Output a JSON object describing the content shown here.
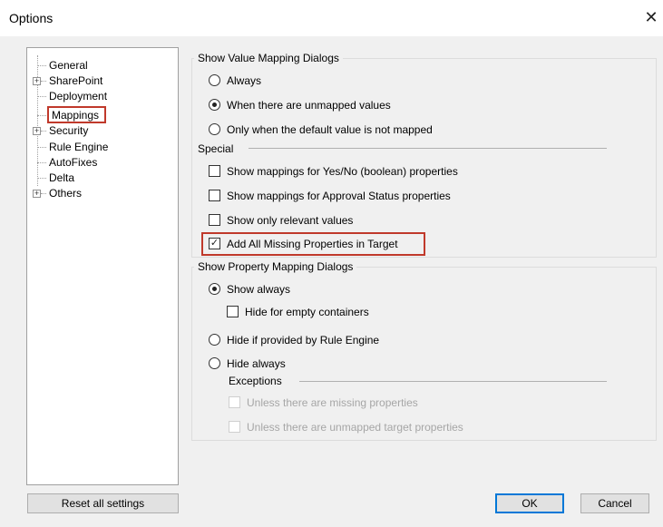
{
  "window": {
    "title": "Options",
    "close_glyph": "✕"
  },
  "tree": {
    "items": [
      {
        "label": "General",
        "expander": false
      },
      {
        "label": "SharePoint",
        "expander": true
      },
      {
        "label": "Deployment",
        "expander": false
      },
      {
        "label": "Mappings",
        "expander": false,
        "selected": true
      },
      {
        "label": "Security",
        "expander": true
      },
      {
        "label": "Rule Engine",
        "expander": false
      },
      {
        "label": "AutoFixes",
        "expander": false
      },
      {
        "label": "Delta",
        "expander": false
      },
      {
        "label": "Others",
        "expander": true
      }
    ]
  },
  "value_mapping": {
    "title": "Show Value Mapping Dialogs",
    "options": [
      {
        "label": "Always",
        "selected": false
      },
      {
        "label": "When there are unmapped values",
        "selected": true
      },
      {
        "label": "Only when the default value is not mapped",
        "selected": false
      }
    ]
  },
  "special": {
    "title": "Special",
    "checks": [
      {
        "label": "Show mappings for Yes/No (boolean) properties",
        "checked": false
      },
      {
        "label": "Show mappings for Approval Status properties",
        "checked": false
      },
      {
        "label": "Show only relevant values",
        "checked": false
      },
      {
        "label": "Add All Missing Properties in Target",
        "checked": true
      }
    ]
  },
  "property_mapping": {
    "title": "Show Property Mapping Dialogs",
    "show_always": "Show always",
    "hide_empty": "Hide for empty containers",
    "hide_rule_engine": "Hide if provided by Rule Engine",
    "hide_always": "Hide always",
    "exceptions_title": "Exceptions",
    "exc_missing": "Unless there are missing properties",
    "exc_unmapped": "Unless there are unmapped target properties"
  },
  "buttons": {
    "reset": "Reset all settings",
    "ok": "OK",
    "cancel": "Cancel"
  }
}
